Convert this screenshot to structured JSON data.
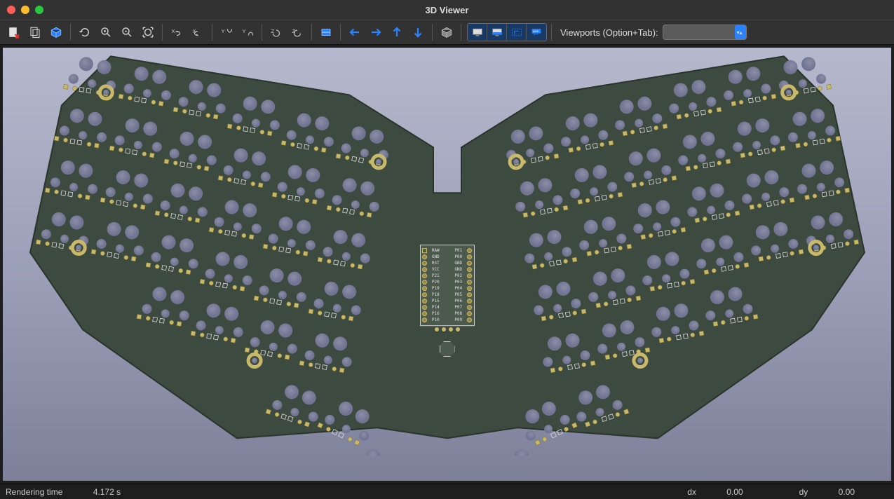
{
  "window": {
    "title": "3D Viewer"
  },
  "toolbar": {
    "viewports_label": "Viewports (Option+Tab):",
    "viewports_value": ""
  },
  "mcu": {
    "left": [
      "RAW",
      "GND",
      "RST",
      "VCC",
      "P21",
      "P20",
      "P19",
      "P18",
      "P15",
      "P14",
      "P16",
      "P10"
    ],
    "right": [
      "P01",
      "P00",
      "GND",
      "GND",
      "P02",
      "P03",
      "P04",
      "P05",
      "P06",
      "P07",
      "P08",
      "P09"
    ]
  },
  "status": {
    "render_label": "Rendering time",
    "render_time": "4.172 s",
    "dx_label": "dx",
    "dx_value": "0.00",
    "dy_label": "dy",
    "dy_value": "0.00"
  }
}
